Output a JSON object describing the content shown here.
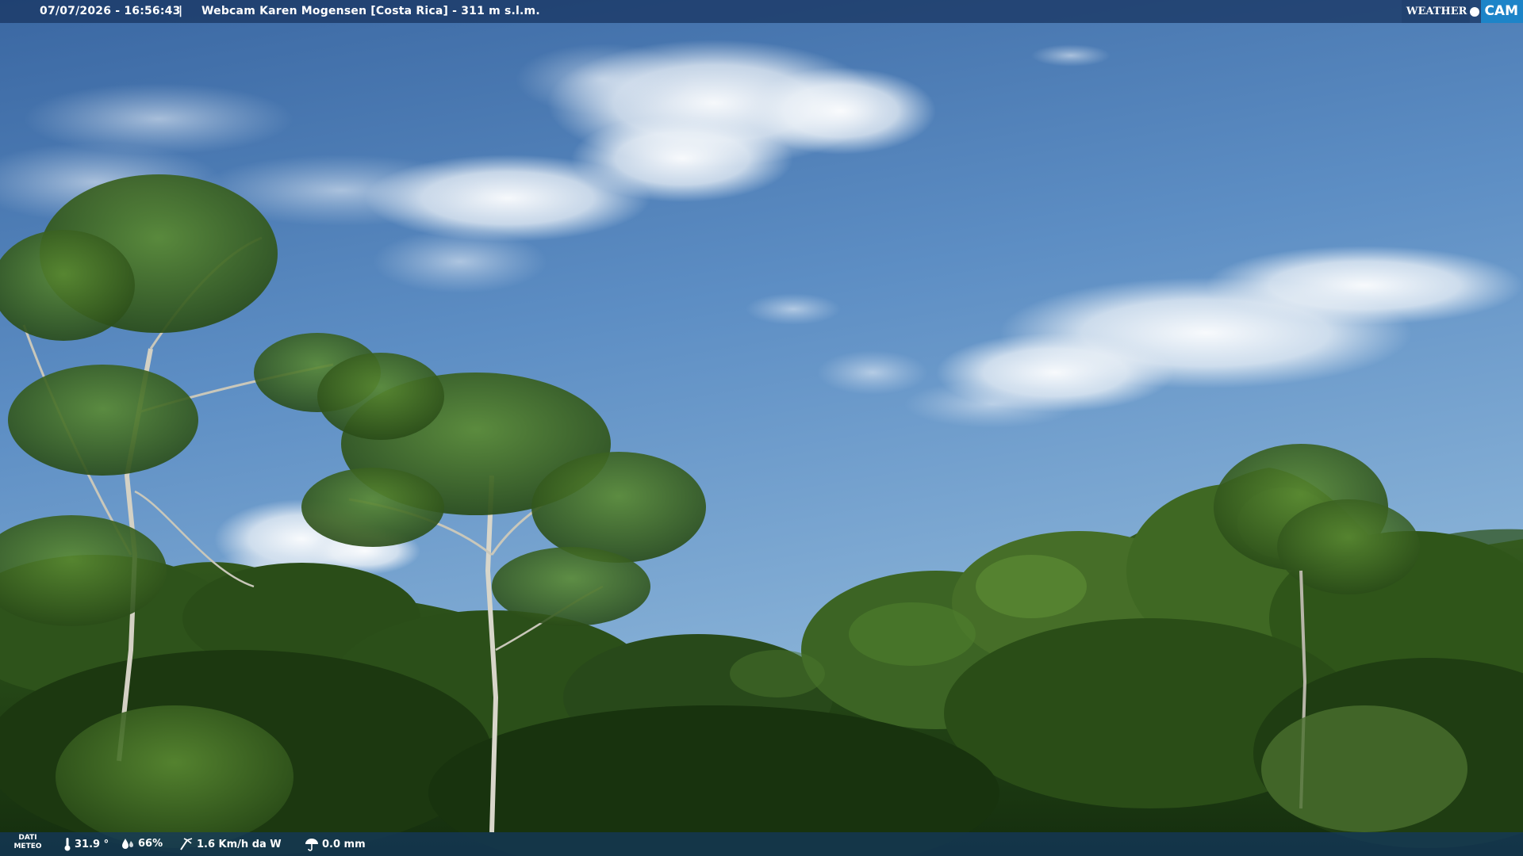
{
  "header": {
    "datetime": "07/07/2026 - 16:56:43",
    "separator": "|",
    "title": "Webcam Karen Mogensen [Costa Rica]  - 311 m s.l.m."
  },
  "logo": {
    "weather": "WEATHER",
    "cam": "CAM"
  },
  "footer": {
    "dati_line1": "DATI",
    "dati_line2": "METEO",
    "temperature": "31.9 °",
    "humidity": "66%",
    "wind": "1.6 Km/h da W",
    "rain": "0.0 mm"
  },
  "colors": {
    "sky_top": "#3d6ea9",
    "sky_bottom": "#86b0d4",
    "foliage_dark": "#173a16",
    "foliage_light": "#4f7a2c",
    "logo_accent": "#1d84c8"
  },
  "icons": {
    "temperature": "thermometer-icon",
    "humidity": "humidity-drop-icon",
    "wind": "wind-icon",
    "rain": "umbrella-icon"
  }
}
